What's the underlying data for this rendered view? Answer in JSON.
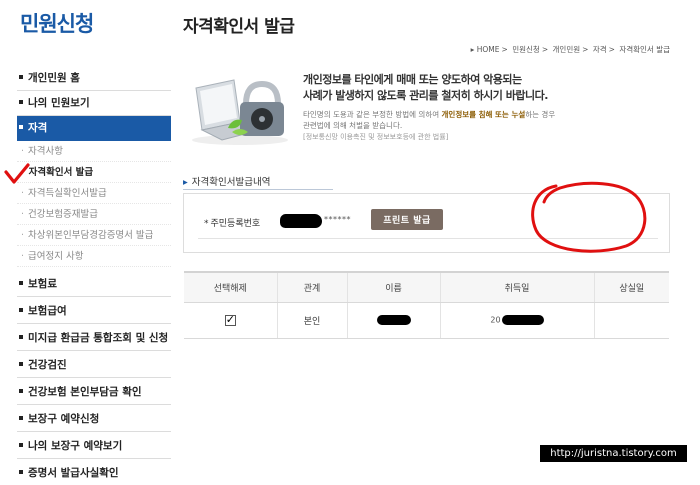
{
  "sidebar": {
    "title": "민원신청",
    "items": [
      {
        "label": "개인민원 홈"
      },
      {
        "label": "나의 민원보기"
      },
      {
        "label": "자격"
      }
    ],
    "subitems": [
      {
        "label": "자격사항"
      },
      {
        "label": "자격확인서 발급"
      },
      {
        "label": "자격득실확인서발급"
      },
      {
        "label": "건강보험증재발급"
      },
      {
        "label": "차상위본인부담경감증명서 발급"
      },
      {
        "label": "급여정지 사항"
      }
    ],
    "items_after": [
      {
        "label": "보험료"
      },
      {
        "label": "보험급여"
      },
      {
        "label": "미지급 환급금 통합조회 및 신청"
      },
      {
        "label": "건강검진"
      },
      {
        "label": "건강보험 본인부담금 확인"
      },
      {
        "label": "보장구 예약신청"
      },
      {
        "label": "나의 보장구 예약보기"
      },
      {
        "label": "증명서 발급사실확인"
      }
    ]
  },
  "main": {
    "title": "자격확인서 발급",
    "breadcrumb": [
      "HOME",
      "민원신청",
      "개인민원",
      "자격",
      "자격확인서 발급"
    ],
    "notice": {
      "line1": "개인정보를 타인에게 매매 또는 양도하여 악용되는",
      "line2": "사례가 발생하지 않도록 관리를 철저히 하시기 바랍니다.",
      "sub1a": "타인명의 도용과 같은 부정한 방법에 의하여 ",
      "sub1b": "개인정보를 침해 또는 누설",
      "sub1c": "하는 경우",
      "sub2": "관련법에 의해 처벌을 받습니다.",
      "source": "[정보통신망 이용촉진 및 정보보호등에 관한 법률]"
    },
    "section_label": "자격확인서발급내역",
    "form": {
      "rrn_label": "주민등록번호",
      "rrn_mask": "******",
      "print_button": "프린트 발급"
    },
    "table": {
      "headers": [
        "선택해제",
        "관계",
        "이름",
        "취득일",
        "상실일"
      ],
      "rows": [
        {
          "relation": "본인",
          "acquired_prefix": "20",
          "lost": ""
        }
      ]
    }
  },
  "watermark": "http://juristna.tistory.com",
  "colors": {
    "accent": "#1a5aa6",
    "button": "#7a6b62",
    "annotation": "#e01010"
  }
}
